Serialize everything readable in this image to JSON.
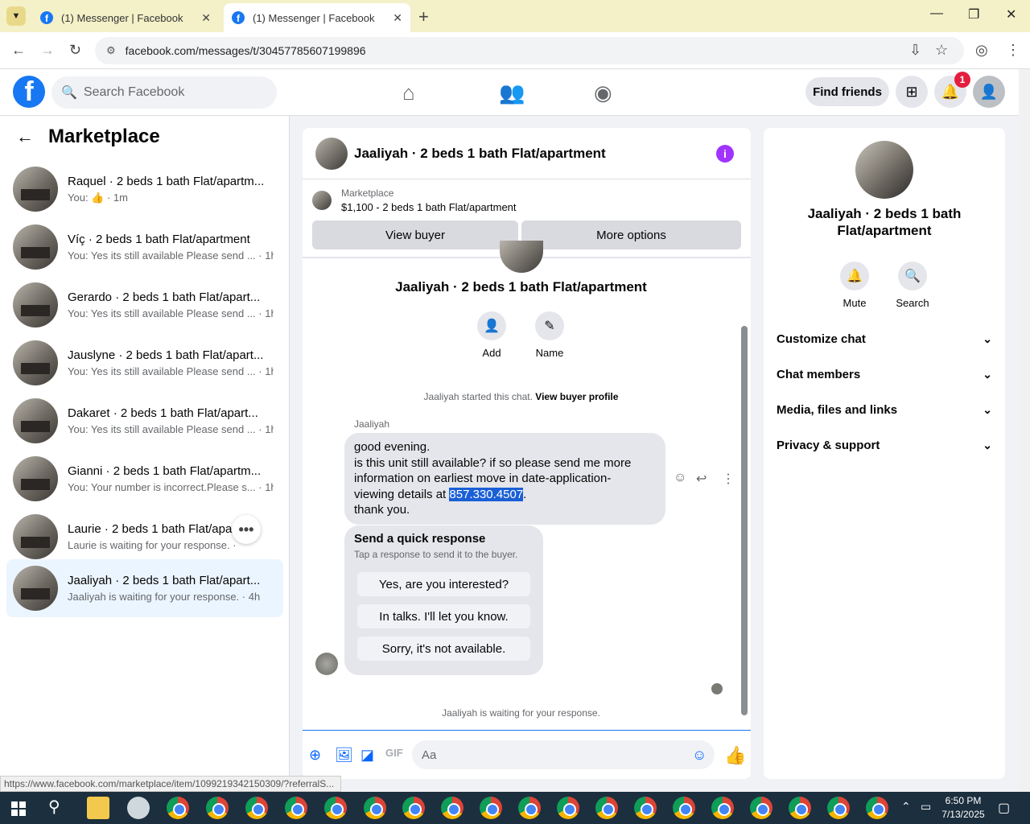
{
  "browser": {
    "tabs": [
      {
        "title": "(1) Messenger | Facebook"
      },
      {
        "title": "(1) Messenger | Facebook"
      }
    ],
    "url": "facebook.com/messages/t/30457785607199896",
    "status_link": "https://www.facebook.com/marketplace/item/1099219342150309/?referralS..."
  },
  "fb_header": {
    "search_placeholder": "Search Facebook",
    "find_friends": "Find friends",
    "notification_count": "1"
  },
  "sidebar": {
    "title": "Marketplace",
    "conversations": [
      {
        "name": "Raquel · 2 beds 1 bath Flat/apartm...",
        "preview": "You: 👍 · 1m"
      },
      {
        "name": "Víç · 2 beds 1 bath Flat/apartment",
        "preview": "You: Yes its still available Please send ... · 1h"
      },
      {
        "name": "Gerardo · 2 beds 1 bath Flat/apart...",
        "preview": "You: Yes its still available Please send ... · 1h"
      },
      {
        "name": "Jauslyne · 2 beds 1 bath Flat/apart...",
        "preview": "You: Yes its still available Please send ... · 1h"
      },
      {
        "name": "Dakaret · 2 beds 1 bath Flat/apart...",
        "preview": "You: Yes its still available Please send ... · 1h"
      },
      {
        "name": "Gianni · 2 beds 1 bath Flat/apartm...",
        "preview": "You: Your number is incorrect.Please s... · 1h"
      },
      {
        "name": "Laurie · 2 beds 1 bath Flat/apart...",
        "preview": "Laurie is waiting for your response. ·"
      },
      {
        "name": "Jaaliyah · 2 beds 1 bath Flat/apart...",
        "preview": "Jaaliyah is waiting for your response. · 4h"
      }
    ]
  },
  "chat": {
    "title": "Jaaliyah · 2 beds 1 bath Flat/apartment",
    "marketplace_label": "Marketplace",
    "listing": "$1,100 - 2 beds 1 bath Flat/apartment",
    "view_buyer": "View buyer",
    "more_options": "More options",
    "convo_name": "Jaaliyah · 2 beds 1 bath Flat/apartment",
    "add_label": "Add",
    "name_label": "Name",
    "started_text": "Jaaliyah started this chat.",
    "view_buyer_profile": "View buyer profile",
    "sender": "Jaaliyah",
    "message_lines": [
      "good evening.",
      "is this unit still available? if so please send me more",
      "information on earliest move in date-application-",
      "viewing details at "
    ],
    "phone": "857.330.4507",
    "phone_suffix": ".",
    "message_end": "thank you.",
    "quick_title": "Send a quick response",
    "quick_sub": "Tap a response to send it to the buyer.",
    "quick_responses": [
      "Yes, are you interested?",
      "In talks. I'll let you know.",
      "Sorry, it's not available."
    ],
    "waiting": "Jaaliyah is waiting for your response.",
    "compose_placeholder": "Aa"
  },
  "right_panel": {
    "name": "Jaaliyah · 2 beds 1 bath Flat/apartment",
    "mute": "Mute",
    "search": "Search",
    "sections": [
      "Customize chat",
      "Chat members",
      "Media, files and links",
      "Privacy & support"
    ]
  },
  "taskbar": {
    "time": "6:50 PM",
    "date": "7/13/2025"
  }
}
